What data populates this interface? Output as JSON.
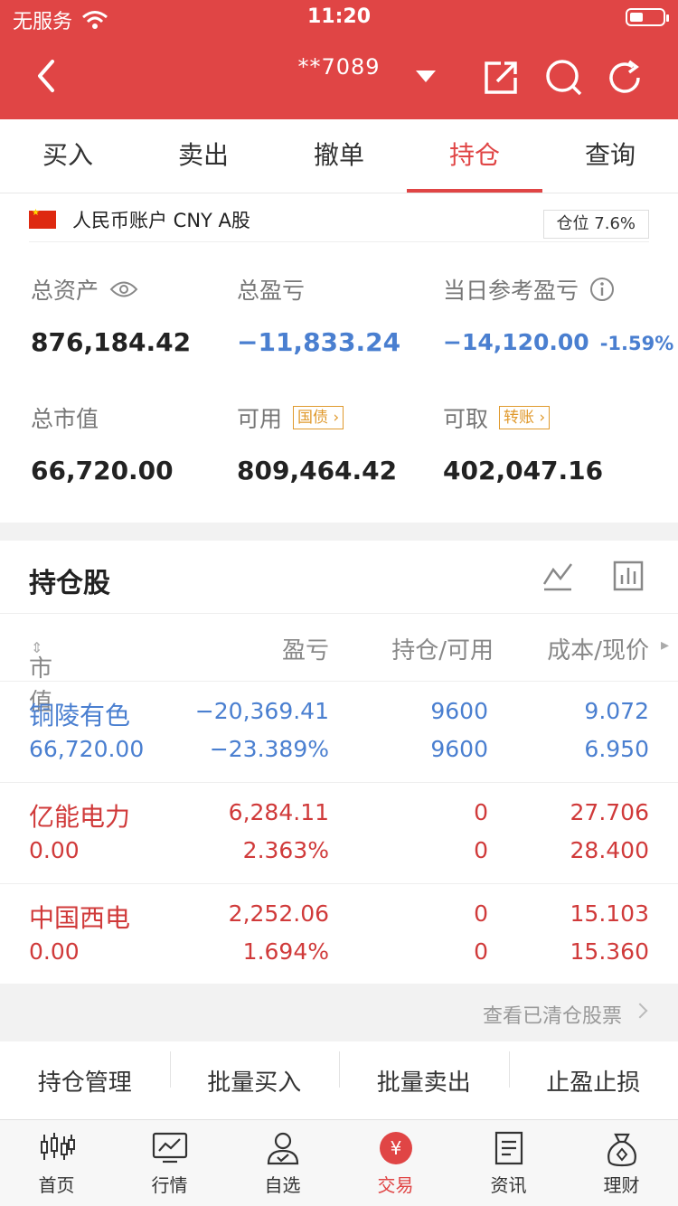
{
  "status": {
    "carrier": "无服务",
    "time": "11:20"
  },
  "nav": {
    "account": "**7089"
  },
  "tabs": [
    "买入",
    "卖出",
    "撤单",
    "持仓",
    "查询"
  ],
  "account": {
    "label": "人民币账户 CNY A股",
    "position_badge": "仓位 7.6%"
  },
  "summary": {
    "total_assets_label": "总资产",
    "total_assets": "876,184.42",
    "total_pl_label": "总盈亏",
    "total_pl": "−11,833.24",
    "daily_pl_label": "当日参考盈亏",
    "daily_pl": "−14,120.00",
    "daily_pl_pct": "-1.59%",
    "market_value_label": "总市值",
    "market_value": "66,720.00",
    "available_label": "可用",
    "available": "809,464.42",
    "available_tag": "国债",
    "withdrawable_label": "可取",
    "withdrawable": "402,047.16",
    "withdrawable_tag": "转账"
  },
  "holdings": {
    "title": "持仓股",
    "columns": [
      "市值",
      "盈亏",
      "持仓/可用",
      "成本/现价"
    ],
    "rows": [
      {
        "name": "铜陵有色",
        "value": "66,720.00",
        "pl": "−20,369.41",
        "pl_pct": "−23.389%",
        "hold": "9600",
        "avail": "9600",
        "cost": "9.072",
        "price": "6.950",
        "color": "#4a7fd0"
      },
      {
        "name": "亿能电力",
        "value": "0.00",
        "pl": "6,284.11",
        "pl_pct": "2.363%",
        "hold": "0",
        "avail": "0",
        "cost": "27.706",
        "price": "28.400",
        "color": "#d03a3a"
      },
      {
        "name": "中国西电",
        "value": "0.00",
        "pl": "2,252.06",
        "pl_pct": "1.694%",
        "hold": "0",
        "avail": "0",
        "cost": "15.103",
        "price": "15.360",
        "color": "#d03a3a"
      }
    ],
    "cleared_link": "查看已清仓股票"
  },
  "actions": [
    "持仓管理",
    "批量买入",
    "批量卖出",
    "止盈止损"
  ],
  "tabbar": [
    {
      "label": "首页",
      "icon": "candlestick-icon"
    },
    {
      "label": "行情",
      "icon": "chart-icon"
    },
    {
      "label": "自选",
      "icon": "user-check-icon"
    },
    {
      "label": "交易",
      "icon": "yuan-icon"
    },
    {
      "label": "资讯",
      "icon": "document-icon"
    },
    {
      "label": "理财",
      "icon": "money-bag-icon"
    }
  ],
  "colors": {
    "brand": "#e04545",
    "loss": "#4a7fd0",
    "gain": "#d03a3a",
    "tag": "#e09a2e"
  }
}
